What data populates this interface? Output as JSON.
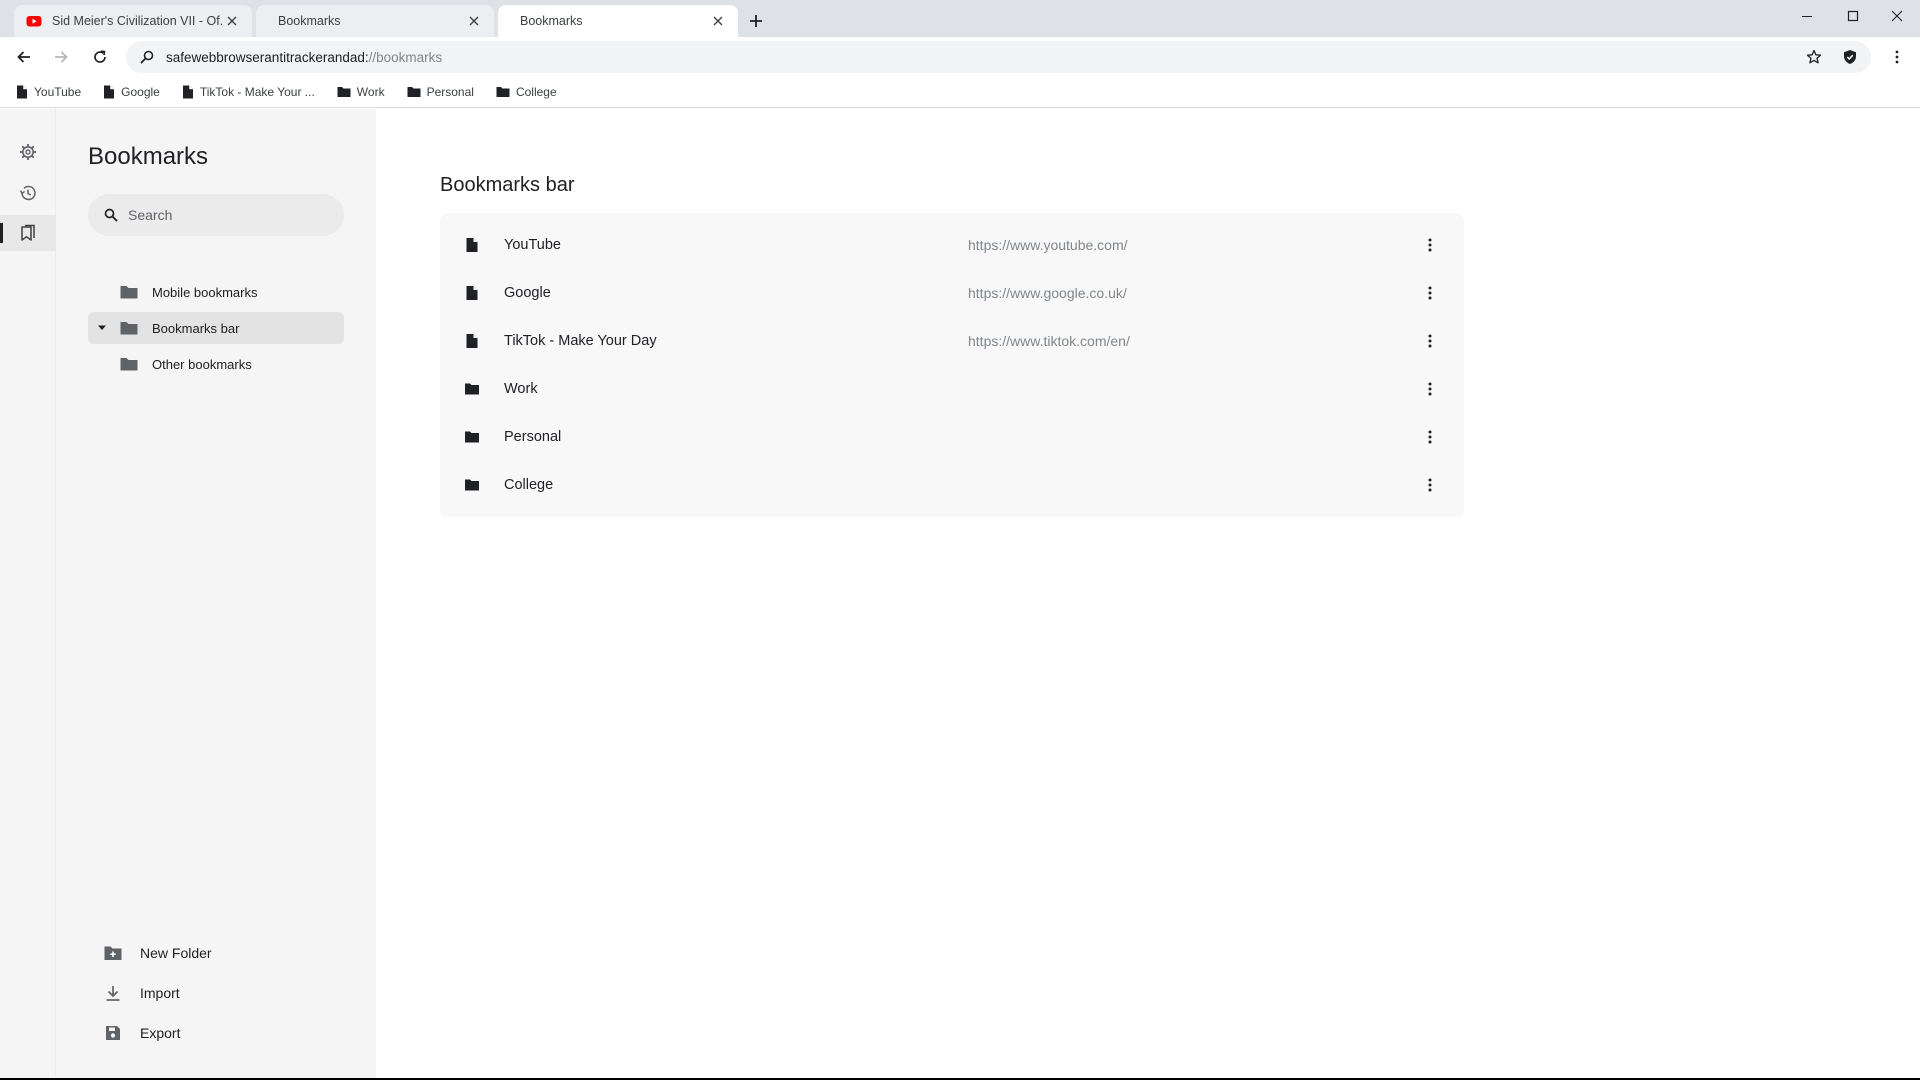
{
  "tabs": [
    {
      "title": "Sid Meier's Civilization VII - Of...",
      "favicon": "youtube-favicon"
    },
    {
      "title": "Bookmarks",
      "favicon": ""
    },
    {
      "title": "Bookmarks",
      "favicon": ""
    }
  ],
  "address": {
    "host": "safewebbrowserantitrackerandad:",
    "path": "//bookmarks"
  },
  "bookmarks_bar": [
    {
      "label": "YouTube",
      "icon": "page-icon"
    },
    {
      "label": "Google",
      "icon": "page-icon"
    },
    {
      "label": "TikTok - Make Your ...",
      "icon": "page-icon"
    },
    {
      "label": "Work",
      "icon": "folder-icon"
    },
    {
      "label": "Personal",
      "icon": "folder-icon"
    },
    {
      "label": "College",
      "icon": "folder-icon"
    }
  ],
  "sidebar": {
    "title": "Bookmarks",
    "search_placeholder": "Search",
    "tree": [
      {
        "label": "Mobile bookmarks"
      },
      {
        "label": "Bookmarks bar",
        "selected": true,
        "expanded": true
      },
      {
        "label": "Other bookmarks"
      }
    ],
    "actions": [
      {
        "label": "New Folder",
        "icon": "new-folder-icon"
      },
      {
        "label": "Import",
        "icon": "import-icon"
      },
      {
        "label": "Export",
        "icon": "export-icon"
      }
    ]
  },
  "main": {
    "title": "Bookmarks bar",
    "items": [
      {
        "name": "YouTube",
        "url": "https://www.youtube.com/",
        "type": "page"
      },
      {
        "name": "Google",
        "url": "https://www.google.co.uk/",
        "type": "page"
      },
      {
        "name": "TikTok - Make Your Day",
        "url": "https://www.tiktok.com/en/",
        "type": "page"
      },
      {
        "name": "Work",
        "url": "",
        "type": "folder"
      },
      {
        "name": "Personal",
        "url": "",
        "type": "folder"
      },
      {
        "name": "College",
        "url": "",
        "type": "folder"
      }
    ]
  },
  "colors": {
    "tabstrip": "#dee1e6",
    "sidebar": "#f5f5f5",
    "youtube_red": "#ff0000",
    "url_gray": "#80868b"
  }
}
